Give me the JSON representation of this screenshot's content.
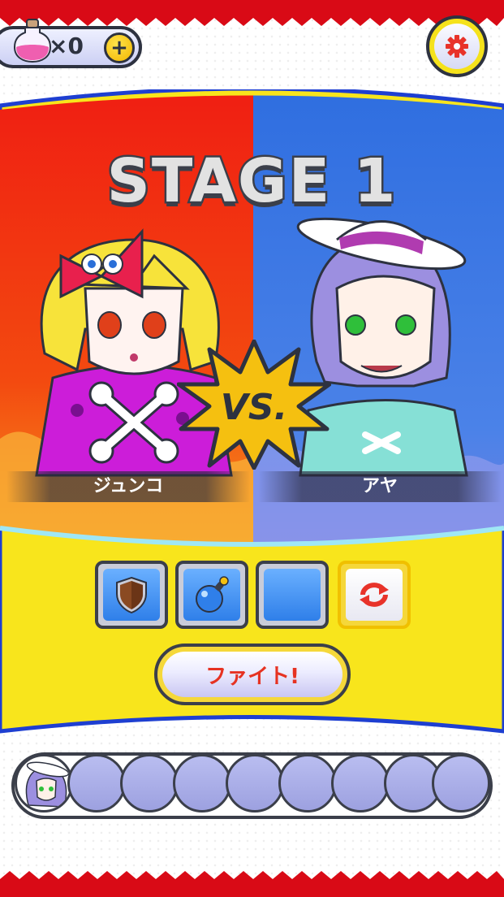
{
  "hud": {
    "potion_icon": "pink-potion-icon",
    "potion_count": "×0",
    "plus_label": "+",
    "settings_icon": "gear-icon"
  },
  "stage": {
    "title": "STAGE 1",
    "vs_label": "VS."
  },
  "fighters": {
    "left": {
      "name": "ジュンコ",
      "side_color": "#f03a12"
    },
    "right": {
      "name": "アヤ",
      "side_color": "#3a7ae6"
    }
  },
  "items": [
    {
      "icon": "shield-icon"
    },
    {
      "icon": "bomb-icon"
    },
    {
      "icon": "empty-slot"
    },
    {
      "icon": "refresh-icon"
    }
  ],
  "fight_button": {
    "label": "ファイト!"
  },
  "roster": {
    "slots": [
      {
        "state": "current-opponent"
      },
      {
        "state": "locked"
      },
      {
        "state": "locked"
      },
      {
        "state": "locked"
      },
      {
        "state": "locked"
      },
      {
        "state": "locked"
      },
      {
        "state": "locked"
      },
      {
        "state": "locked"
      },
      {
        "state": "locked"
      }
    ]
  },
  "colors": {
    "frame_red": "#d90a16",
    "panel_yellow": "#f8e51c",
    "border_blue": "#1e3fd1",
    "outline": "#3b3f4a",
    "fight_text": "#e63222"
  }
}
